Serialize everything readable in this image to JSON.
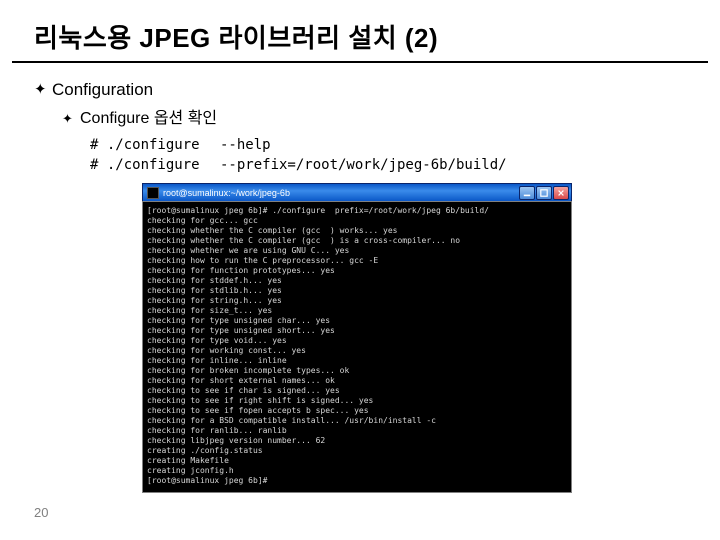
{
  "title": "리눅스용 JPEG 라이브러리 설치 (2)",
  "bullets": {
    "level1": "Configuration",
    "level2": "Configure 옵션 확인"
  },
  "commands": [
    {
      "cmd": "# ./configure",
      "arg": "--help"
    },
    {
      "cmd": "# ./configure",
      "arg": "--prefix=/root/work/jpeg-6b/build/"
    }
  ],
  "terminal": {
    "title": "root@sumalinux:~/work/jpeg-6b",
    "icons": {
      "app": "terminal-icon",
      "min": "minimize-icon",
      "max": "maximize-icon",
      "close": "close-icon"
    },
    "lines": [
      "[root@sumalinux jpeg 6b]# ./configure  prefix=/root/work/jpeg 6b/build/",
      "checking for gcc... gcc",
      "checking whether the C compiler (gcc  ) works... yes",
      "checking whether the C compiler (gcc  ) is a cross-compiler... no",
      "checking whether we are using GNU C... yes",
      "checking how to run the C preprocessor... gcc -E",
      "checking for function prototypes... yes",
      "checking for stddef.h... yes",
      "checking for stdlib.h... yes",
      "checking for string.h... yes",
      "checking for size_t... yes",
      "checking for type unsigned char... yes",
      "checking for type unsigned short... yes",
      "checking for type void... yes",
      "checking for working const... yes",
      "checking for inline... inline",
      "checking for broken incomplete types... ok",
      "checking for short external names... ok",
      "checking to see if char is signed... yes",
      "checking to see if right shift is signed... yes",
      "checking to see if fopen accepts b spec... yes",
      "checking for a BSD compatible install... /usr/bin/install -c",
      "checking for ranlib... ranlib",
      "checking libjpeg version number... 62",
      "creating ./config.status",
      "creating Makefile",
      "creating jconfig.h",
      "[root@sumalinux jpeg 6b]#"
    ]
  },
  "page_number": "20"
}
